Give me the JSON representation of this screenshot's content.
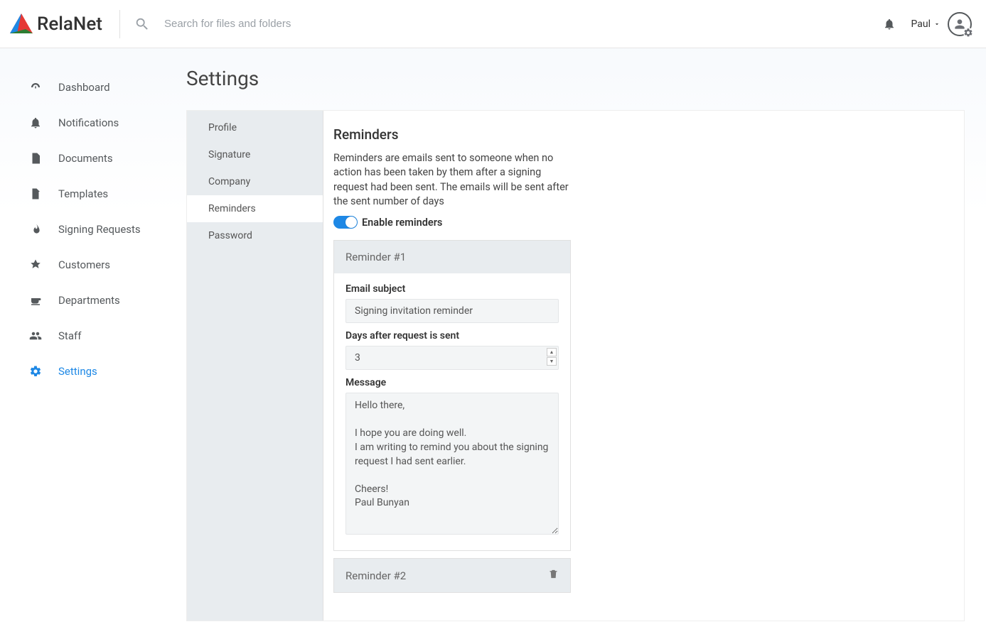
{
  "app": {
    "name": "RelaNet"
  },
  "header": {
    "search_placeholder": "Search for files and folders",
    "user_name": "Paul"
  },
  "sidebar": {
    "items": [
      {
        "label": "Dashboard",
        "icon": "dashboard"
      },
      {
        "label": "Notifications",
        "icon": "bell"
      },
      {
        "label": "Documents",
        "icon": "document"
      },
      {
        "label": "Templates",
        "icon": "file"
      },
      {
        "label": "Signing Requests",
        "icon": "flame"
      },
      {
        "label": "Customers",
        "icon": "badge"
      },
      {
        "label": "Departments",
        "icon": "coffee"
      },
      {
        "label": "Staff",
        "icon": "people"
      },
      {
        "label": "Settings",
        "icon": "gear",
        "active": true
      }
    ]
  },
  "page": {
    "title": "Settings"
  },
  "settings_tabs": [
    {
      "label": "Profile"
    },
    {
      "label": "Signature"
    },
    {
      "label": "Company"
    },
    {
      "label": "Reminders",
      "active": true
    },
    {
      "label": "Password"
    }
  ],
  "reminders": {
    "title": "Reminders",
    "description": "Reminders are emails sent to someone when no action has been taken by them after a signing request had been sent. The emails will be sent after the sent number of days",
    "toggle_label": "Enable reminders",
    "toggle_on": true,
    "cards": [
      {
        "title": "Reminder #1",
        "deletable": false,
        "subject_label": "Email subject",
        "subject_value": "Signing invitation reminder",
        "days_label": "Days after request is sent",
        "days_value": "3",
        "message_label": "Message",
        "message_value": "Hello there,\n\nI hope you are doing well.\nI am writing to remind you about the signing request I had sent earlier.\n\nCheers!\nPaul Bunyan"
      },
      {
        "title": "Reminder #2",
        "deletable": true
      }
    ]
  }
}
